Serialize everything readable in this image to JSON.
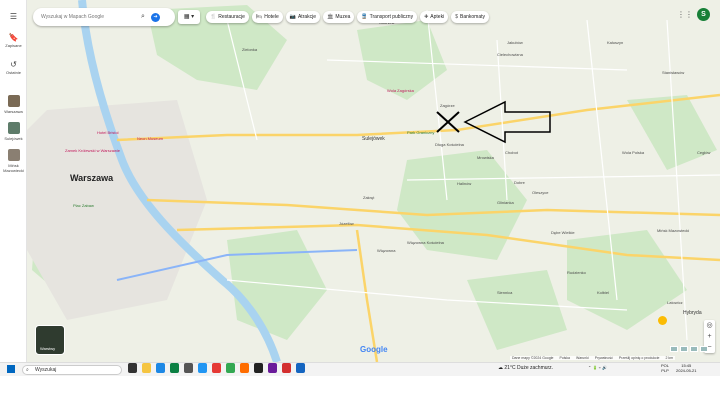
{
  "rail": {
    "items": [
      {
        "label": "",
        "icon": "menu-icon"
      },
      {
        "label": "Zapisane",
        "icon": "bookmark-icon"
      },
      {
        "label": "Ostatnie",
        "icon": "history-icon"
      },
      {
        "label": "Warszawa",
        "icon": "recent-place-thumb"
      },
      {
        "label": "Sulejówek",
        "icon": "recent-place-thumb"
      },
      {
        "label": "Mińsk Mazowiecki",
        "icon": "recent-place-thumb"
      }
    ]
  },
  "search": {
    "placeholder": "Wyszukaj w Mapach Google"
  },
  "chips": [
    {
      "label": "Restauracje",
      "icon": "fork-knife-icon"
    },
    {
      "label": "Hotele",
      "icon": "bed-icon"
    },
    {
      "label": "Atrakcje",
      "icon": "camera-icon"
    },
    {
      "label": "Muzea",
      "icon": "museum-icon"
    },
    {
      "label": "Transport publiczny",
      "icon": "train-icon"
    },
    {
      "label": "Apteki",
      "icon": "pharmacy-icon"
    },
    {
      "label": "Bankomaty",
      "icon": "atm-icon"
    }
  ],
  "account": {
    "initial": "S"
  },
  "map_labels": {
    "city": "Warszawa",
    "towns": [
      "Sulejówek",
      "Zielonka",
      "Zagórze",
      "Okuniew",
      "Zakręt",
      "Halinów",
      "Długa Kościelna",
      "Dębe Wielkie",
      "Mińsk Mazowiecki",
      "Stanisławów",
      "Cegłów",
      "Józefów",
      "Wiązowna",
      "Glinianka",
      "Kołbiel",
      "Siennica",
      "Latowicz",
      "Jakubów",
      "Kałuszyn",
      "Rudzienko",
      "Cielechowizna",
      "Wiązowna Kościelna",
      "Mrowiska",
      "Chobot",
      "Wola Polska",
      "Dobre",
      "Oleszyce"
    ],
    "pois": [
      "Zamek Królewski w Warszawie",
      "Hotel Bristol",
      "Neon Museum",
      "Plac Zabaw",
      "Park Graniczny",
      "Wola Zagórska"
    ]
  },
  "layers_tile": {
    "label": "Warstwy"
  },
  "hybrid_label": "Hybryda",
  "google_logo": "Google",
  "footer": [
    "Dane mapy ©2024 Google",
    "Polska",
    "Warunki",
    "Prywatność",
    "Prześlij opinię o produkcie",
    "2 km"
  ],
  "taskbar": {
    "search_label": "Wyszukaj",
    "weather": "21°C  Duże zachmurz.",
    "lang": [
      "POL",
      "PLP"
    ],
    "time": "15:45",
    "date": "2024-05-21"
  },
  "colors": {
    "map_bg": "#eef0e6",
    "forest": "#cfe8c6",
    "water": "#a9d3f0",
    "road_major": "#fbd469",
    "road_minor": "#ffffff",
    "accent": "#1a73e8",
    "avatar": "#188038"
  }
}
